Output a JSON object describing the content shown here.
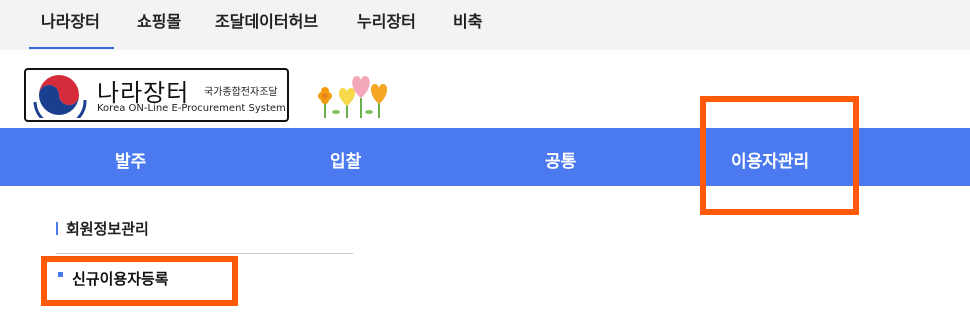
{
  "top_tabs": [
    "나라장터",
    "쇼핑몰",
    "조달데이터허브",
    "누리장터",
    "비축"
  ],
  "logo": {
    "title": "나라장터",
    "subtitle": "국가종합전자조달",
    "english": "Korea ON-Line E-Procurement System"
  },
  "main_menu": [
    "발주",
    "입찰",
    "공통",
    "이용자관리"
  ],
  "sidebar": {
    "section_title": "회원정보관리",
    "items": [
      "신규이용자등록"
    ]
  },
  "colors": {
    "accent": "#4b7af0",
    "highlight": "#ff5a0a",
    "top_bar": "#f3f3f5"
  }
}
